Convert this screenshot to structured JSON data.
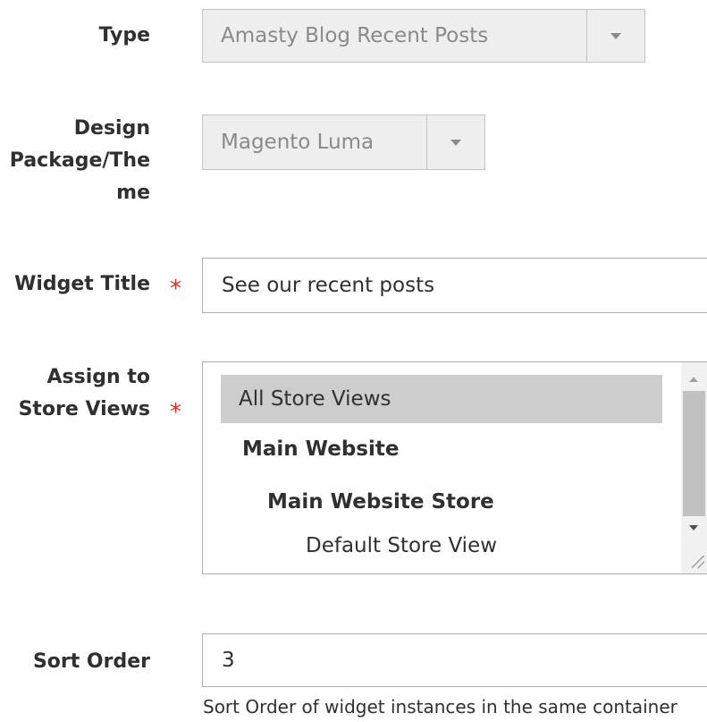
{
  "type_field": {
    "label": "Type",
    "value": "Amasty Blog Recent Posts"
  },
  "design_field": {
    "label_lines": [
      "Design",
      "Package/The",
      "me"
    ],
    "value": "Magento Luma"
  },
  "title_field": {
    "label": "Widget Title",
    "required_mark": "*",
    "value": "See our recent posts"
  },
  "store_views_field": {
    "label_lines": [
      "Assign to",
      "Store Views"
    ],
    "required_mark": "*",
    "options": [
      {
        "label": "All Store Views",
        "selected": true
      },
      {
        "label": "Main Website",
        "group": true
      },
      {
        "label": "Main Website Store",
        "group": true
      },
      {
        "label": "Default Store View",
        "selected": false
      }
    ]
  },
  "sort_order_field": {
    "label": "Sort Order",
    "value": "3",
    "note": "Sort Order of widget instances in the same container"
  },
  "colors": {
    "required": "#e02b27",
    "disabled_bg": "#eeeeee",
    "selected_option_bg": "#cdcdcd"
  }
}
